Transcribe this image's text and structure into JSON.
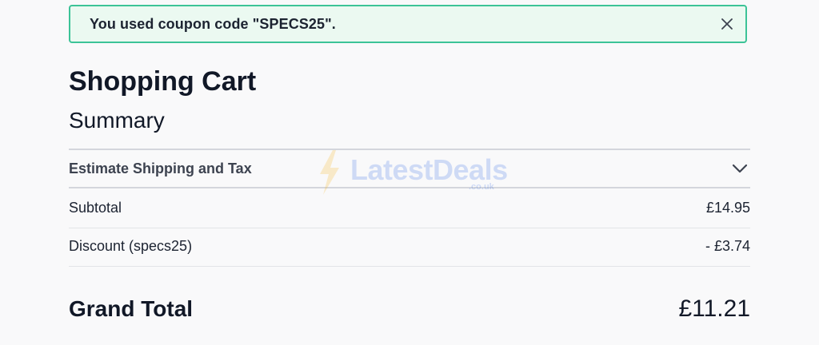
{
  "alert": {
    "message": "You used coupon code \"SPECS25\".",
    "close_icon": "close-icon"
  },
  "cart": {
    "title": "Shopping Cart",
    "summary_heading": "Summary",
    "estimate_label": "Estimate Shipping and Tax",
    "estimate_icon": "chevron-down-icon",
    "subtotal_label": "Subtotal",
    "subtotal_value": "£14.95",
    "discount_label": "Discount (specs25)",
    "discount_value": "- £3.74",
    "grand_total_label": "Grand Total",
    "grand_total_value": "£11.21"
  },
  "watermark": {
    "brand": "LatestDeals",
    "domain": ".co.uk"
  },
  "colors": {
    "alert_border": "#3cc397",
    "alert_background": "#ebf9f1",
    "text_primary": "#111827",
    "watermark": "#3b6fe8"
  }
}
